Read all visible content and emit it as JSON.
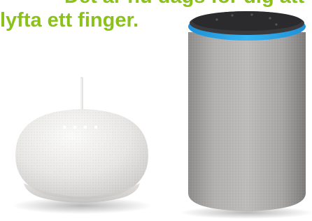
{
  "headline": {
    "line1": "Det är nu dags för dig att",
    "line2": "lyfta ett finger.",
    "color": "#8bc21a"
  },
  "devices": [
    {
      "name": "smart-speaker-mini",
      "color": "#eceae8"
    },
    {
      "name": "smart-speaker-cylinder",
      "color": "#a9a7a5",
      "ring_color": "#2aa3e8"
    }
  ]
}
